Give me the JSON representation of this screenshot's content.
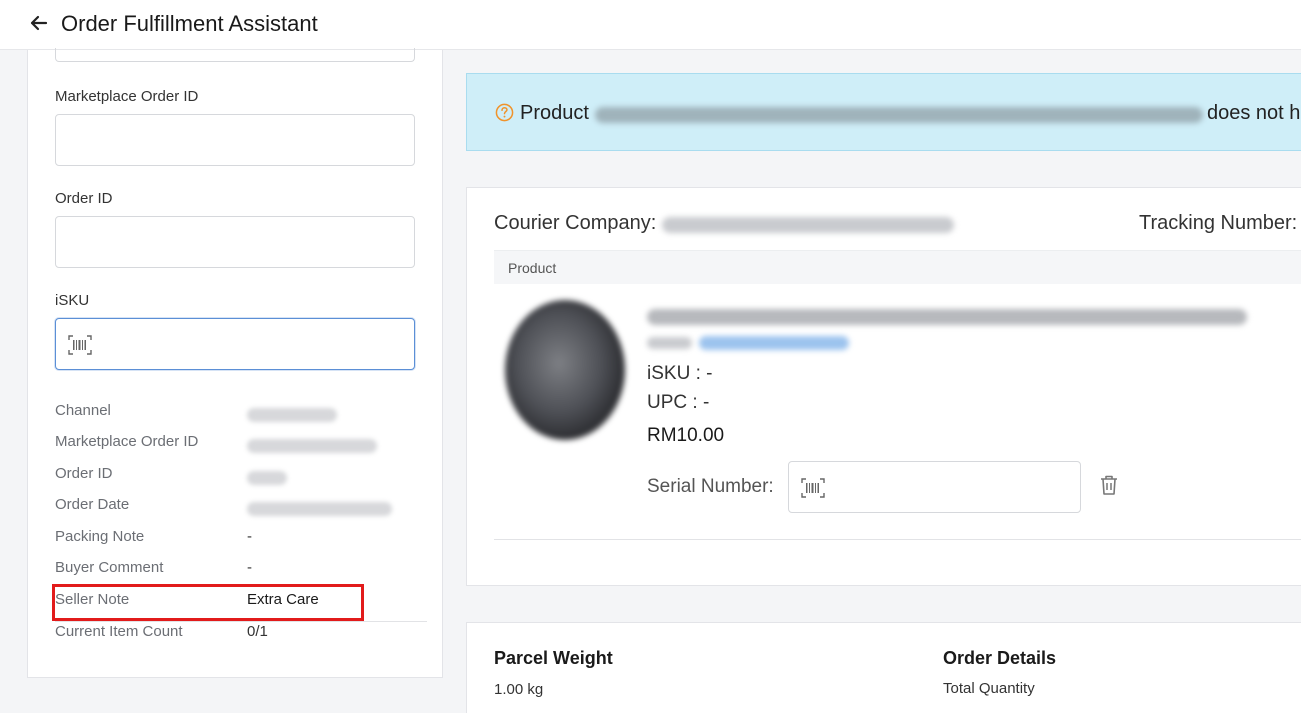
{
  "header": {
    "title": "Order Fulfillment Assistant",
    "back_icon": "arrow-left-icon"
  },
  "search_form": {
    "marketplace_order_id_label": "Marketplace Order ID",
    "marketplace_order_id_value": "",
    "order_id_label": "Order ID",
    "order_id_value": "",
    "isku_label": "iSKU",
    "isku_value": "",
    "isku_icon": "barcode-scan-icon"
  },
  "order_info": {
    "channel_label": "Channel",
    "marketplace_order_id_label": "Marketplace Order ID",
    "order_id_label": "Order ID",
    "order_date_label": "Order Date",
    "packing_note_label": "Packing Note",
    "packing_note_value": "-",
    "buyer_comment_label": "Buyer Comment",
    "buyer_comment_value": "-",
    "seller_note_label": "Seller Note",
    "seller_note_value": "Extra Care",
    "current_item_count_label": "Current Item Count",
    "current_item_count_value": "0/1"
  },
  "banner": {
    "prefix": "Product",
    "suffix": "does not h",
    "icon": "question-circle-icon",
    "color": "#f0932b"
  },
  "shipment": {
    "courier_label": "Courier Company:",
    "tracking_label": "Tracking Number:",
    "product_header": "Product",
    "isku_text": "iSKU : -",
    "upc_text": "UPC : -",
    "price": "RM10.00",
    "serial_label": "Serial Number:",
    "serial_value": "",
    "delete_icon": "trash-icon"
  },
  "summary": {
    "parcel_weight_label": "Parcel Weight",
    "parcel_weight_value": "1.00 kg",
    "order_details_label": "Order Details",
    "total_quantity_label": "Total Quantity"
  },
  "colors": {
    "highlight": "#e21b1b",
    "banner_bg": "#cfeef8",
    "focus": "#5b8fd6"
  }
}
